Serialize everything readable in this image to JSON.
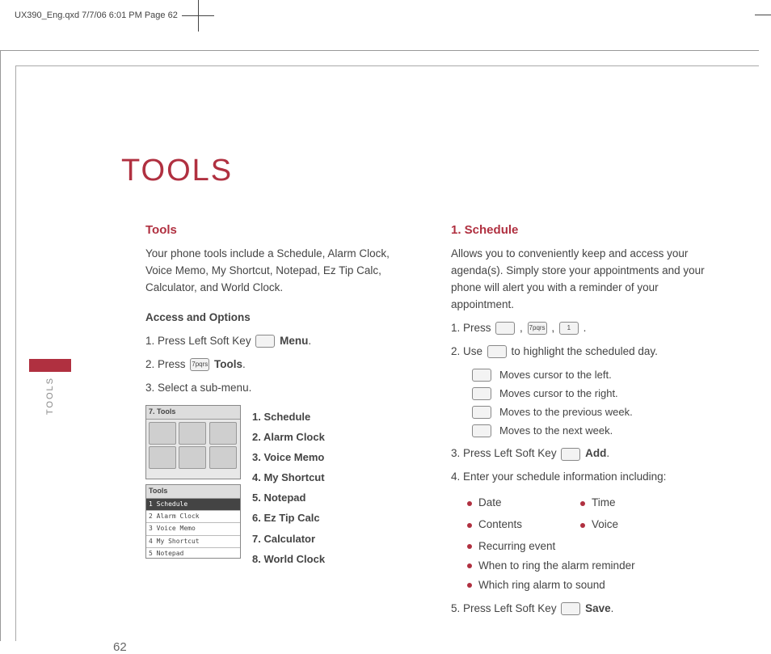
{
  "crop_header": "UX390_Eng.qxd  7/7/06  6:01 PM  Page 62",
  "chapter_title": "TOOLS",
  "side_tab_label": "TOOLS",
  "page_number": "62",
  "left": {
    "heading": "Tools",
    "intro": "Your phone tools include a Schedule, Alarm Clock, Voice Memo, My Shortcut, Notepad, Ez Tip Calc, Calculator, and World Clock.",
    "access_hdr": "Access and Options",
    "step1_a": "1. Press Left Soft Key ",
    "step1_b": " Menu",
    "step2_a": "2. Press ",
    "step2_key": "7pqrs",
    "step2_b": " Tools",
    "step3": "3. Select a sub-menu.",
    "mini1_hdr": "7. Tools",
    "mini2_hdr": "Tools",
    "mini2_rows": {
      "r1": "1 Schedule",
      "r2": "2 Alarm Clock",
      "r3": "3 Voice Memo",
      "r4": "4 My Shortcut",
      "r5": "5 Notepad"
    },
    "submenus": {
      "s1": "1. Schedule",
      "s2": "2. Alarm Clock",
      "s3": "3. Voice Memo",
      "s4": "4. My Shortcut",
      "s5": "5. Notepad",
      "s6": "6. Ez Tip Calc",
      "s7": "7. Calculator",
      "s8": "8. World Clock"
    }
  },
  "right": {
    "heading": "1. Schedule",
    "intro": "Allows you to conveniently keep and access your agenda(s). Simply store your appointments and your phone will alert you with a reminder of your appointment.",
    "step1_a": "1. Press ",
    "step1_sep": ",  ",
    "step1_k2": "7pqrs",
    "step1_k3": "1",
    "step1_end": ".",
    "step2_a": "2. Use ",
    "step2_b": " to highlight the scheduled day.",
    "nav": {
      "n1": "Moves cursor to the left.",
      "n2": "Moves cursor to the right.",
      "n3": "Moves to the previous week.",
      "n4": "Moves to the next week."
    },
    "step3_a": "3. Press Left Soft Key ",
    "step3_b": " Add",
    "step4": "4. Enter your schedule information including:",
    "bullets": {
      "b1": "Date",
      "b2": "Time",
      "b3": "Contents",
      "b4": "Voice",
      "b5": "Recurring event",
      "b6": "When to ring the alarm reminder",
      "b7": "Which ring alarm to sound"
    },
    "step5_a": "5. Press Left Soft Key ",
    "step5_b": " Save"
  }
}
